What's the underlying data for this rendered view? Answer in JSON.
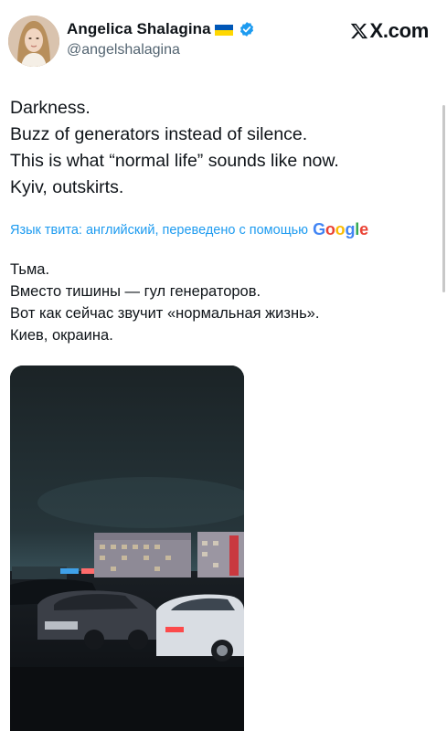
{
  "author": {
    "display_name": "Angelica Shalagina",
    "handle": "@angelshalagina",
    "flag_icon": "ukraine-flag-icon",
    "verified_icon": "verified-badge-icon",
    "verified_color": "#1d9bf0"
  },
  "brand": {
    "label": "X.com",
    "icon": "x-logo-icon"
  },
  "tweet": {
    "lines": [
      "Darkness.",
      "Buzz of generators instead of silence.",
      "This is what “normal life” sounds like now.",
      "Kyiv, outskirts."
    ]
  },
  "translate": {
    "label": "Язык твита: английский, переведено с помощью",
    "provider": "Google",
    "link_color": "#1d9bf0"
  },
  "translation": {
    "lines": [
      "Тьма.",
      "Вместо тишины — гул генераторов.",
      "Вот как сейчас звучит «нормальная жизнь».",
      "Киев, окраина."
    ]
  }
}
